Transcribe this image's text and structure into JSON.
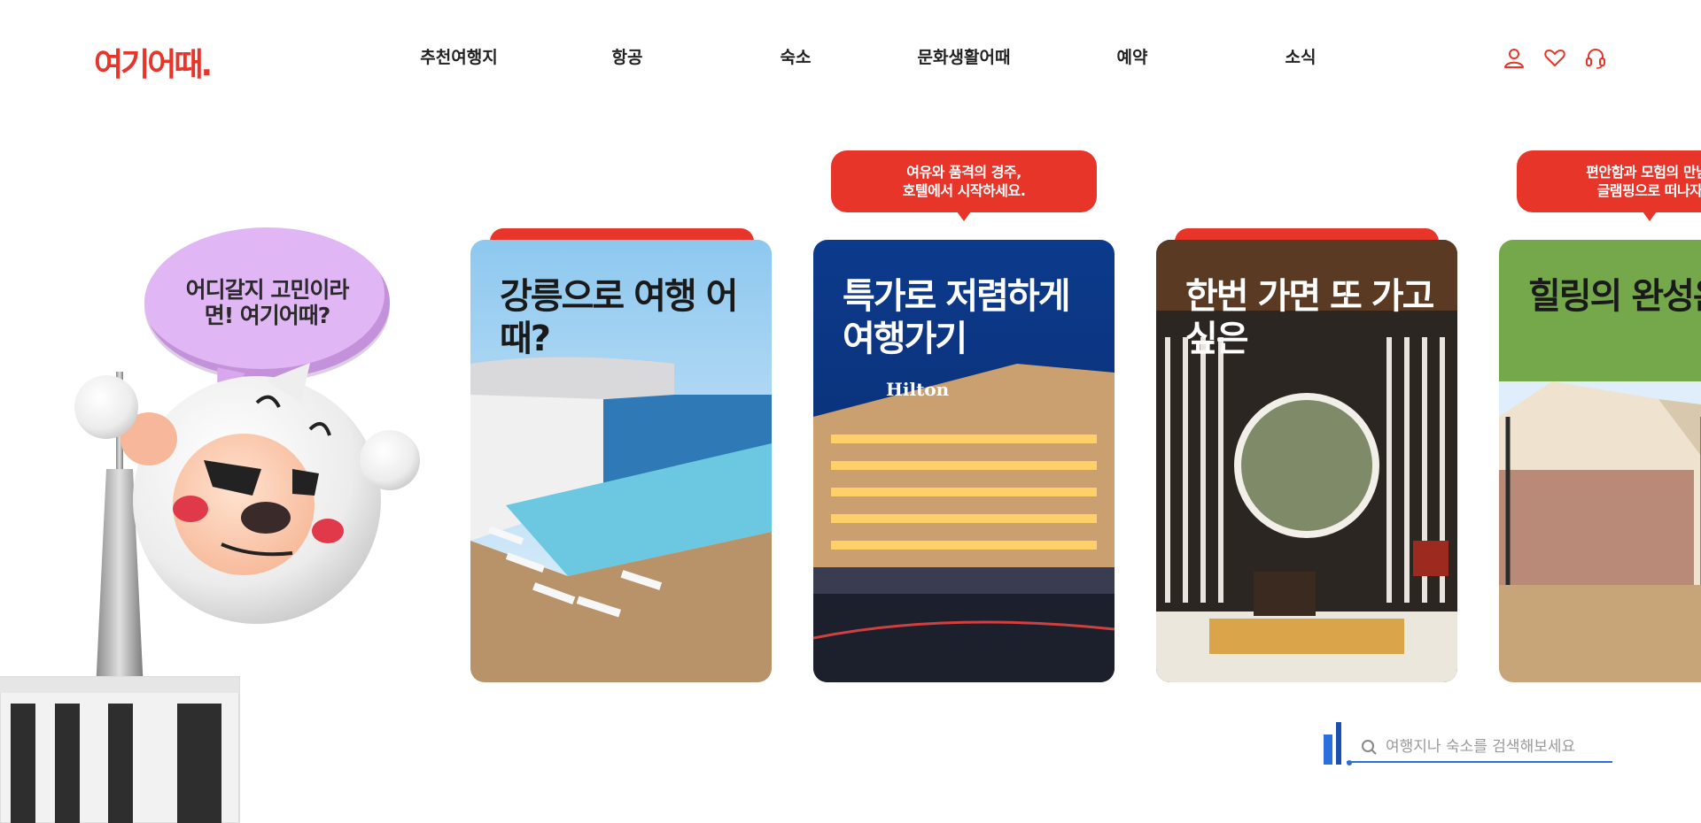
{
  "header": {
    "logo_text": "여기어때.",
    "nav": [
      {
        "label": "추천여행지"
      },
      {
        "label": "항공"
      },
      {
        "label": "숙소"
      },
      {
        "label": "문화생활어때"
      },
      {
        "label": "예약"
      },
      {
        "label": "소식"
      }
    ],
    "icons": [
      "user-icon",
      "heart-icon",
      "headset-icon"
    ]
  },
  "mascot": {
    "speech_text": "어디갈지 고민이라면! 여기어때?"
  },
  "cards": [
    {
      "title": "강릉으로 여행 어때?",
      "bubble": ""
    },
    {
      "title": "특가로 저렴하게 여행가기",
      "bubble": "여유와 품격의 경주,\n호텔에서 시작하세요.",
      "sign": "Hilton"
    },
    {
      "title": "한번 가면 또 가고 싶은",
      "bubble": ""
    },
    {
      "title": "힐링의 완성은?",
      "bubble": "편안함과 모험의 만남,\n글램핑으로 떠나자"
    }
  ],
  "search": {
    "placeholder": "여행지나 숙소를 검색해보세요"
  },
  "colors": {
    "brand": "#e8352a",
    "speech_bubble": "#e1b6f4",
    "search_underline": "#2a6fdb"
  }
}
